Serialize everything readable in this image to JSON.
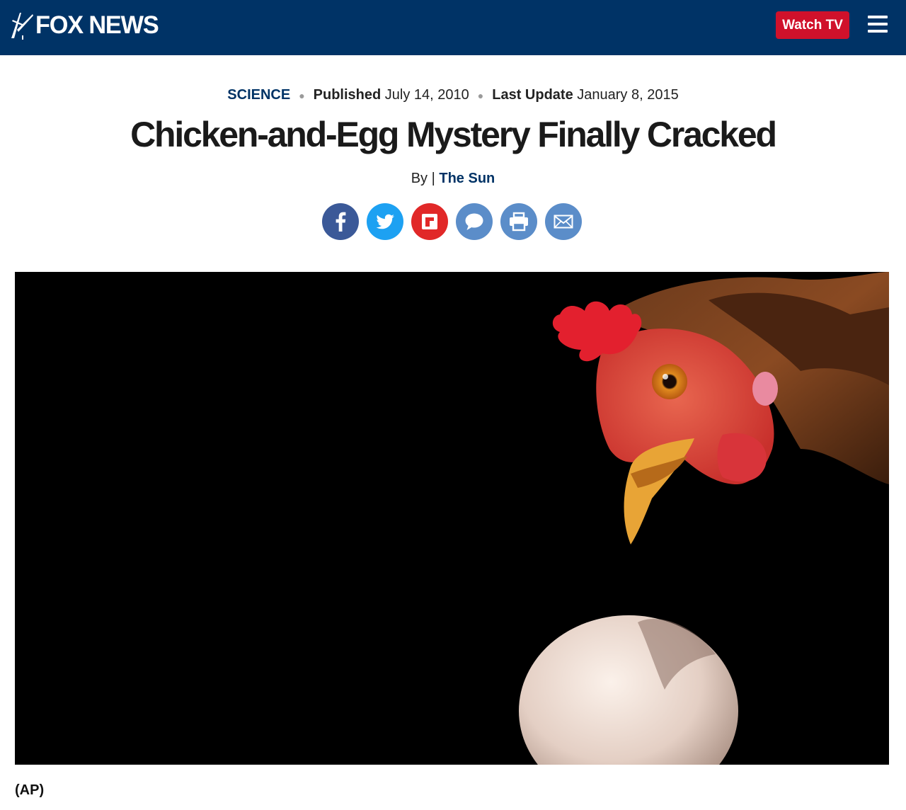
{
  "header": {
    "logo_text": "FOX NEWS",
    "watch_label": "Watch TV",
    "brand_color": "#003366",
    "accent_color": "#d0112b",
    "menu_icon": "hamburger-menu-icon"
  },
  "article": {
    "category": "SCIENCE",
    "published_label": "Published",
    "published_date": "July 14, 2010",
    "updated_label": "Last Update",
    "updated_date": "January 8, 2015",
    "title": "Chicken-and-Egg Mystery Finally Cracked",
    "by_prefix": "By |",
    "author": "The Sun",
    "image_caption": "(AP)"
  },
  "share": [
    {
      "icon": "facebook-icon",
      "color": "#3b5998"
    },
    {
      "icon": "twitter-icon",
      "color": "#1da1f2"
    },
    {
      "icon": "flipboard-icon",
      "color": "#e12828"
    },
    {
      "icon": "comments-icon",
      "color": "#5b8dc9"
    },
    {
      "icon": "print-icon",
      "color": "#5b8dc9"
    },
    {
      "icon": "email-icon",
      "color": "#5b8dc9"
    }
  ]
}
